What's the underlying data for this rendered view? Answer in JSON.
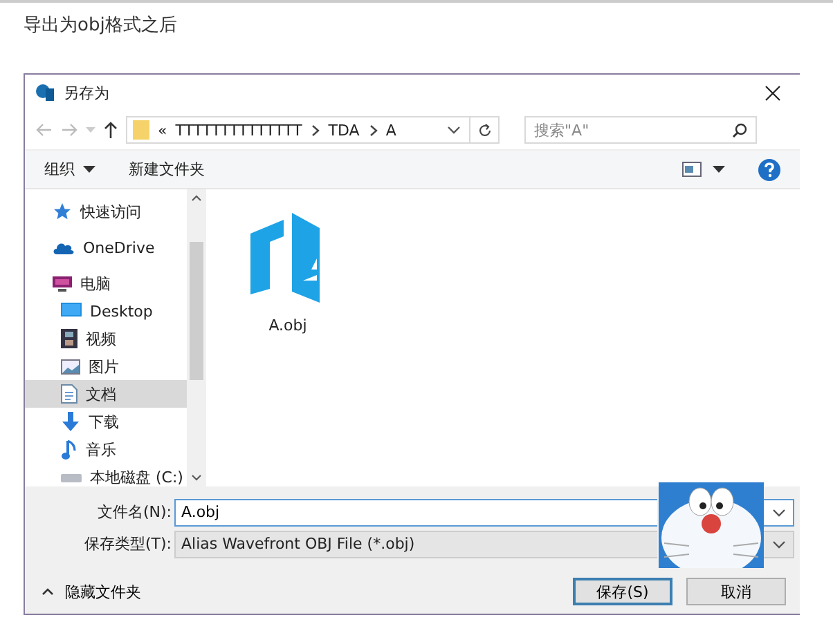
{
  "page_heading": "导出为obj格式之后",
  "dialog": {
    "title": "另存为",
    "path": {
      "overflow": "«",
      "segments": [
        "TTTTTTTTTTTTTT",
        "TDA",
        "A"
      ]
    },
    "search": {
      "placeholder": "搜索\"A\""
    },
    "toolbar": {
      "organize": "组织",
      "new_folder": "新建文件夹"
    },
    "sidebar": [
      {
        "label": "快速访问",
        "kind": "star",
        "selected": false
      },
      {
        "label": "OneDrive",
        "kind": "cloud",
        "selected": false
      },
      {
        "label": "电脑",
        "kind": "pc",
        "selected": false,
        "children": [
          {
            "label": "Desktop",
            "kind": "desktop",
            "selected": false
          },
          {
            "label": "视频",
            "kind": "video",
            "selected": false
          },
          {
            "label": "图片",
            "kind": "picture",
            "selected": false
          },
          {
            "label": "文档",
            "kind": "document",
            "selected": true
          },
          {
            "label": "下载",
            "kind": "download",
            "selected": false
          },
          {
            "label": "音乐",
            "kind": "music",
            "selected": false
          },
          {
            "label": "本地磁盘 (C:)",
            "kind": "drive",
            "selected": false
          }
        ]
      }
    ],
    "files": [
      {
        "name": "A.obj"
      }
    ],
    "file_name": {
      "label": "文件名(N):",
      "value": "A.obj"
    },
    "file_type": {
      "label": "保存类型(T):",
      "value": "Alias Wavefront OBJ File (*.obj)"
    },
    "hide_folders": "隐藏文件夹",
    "buttons": [
      {
        "label": "保存(S)",
        "default": true
      },
      {
        "label": "取消",
        "default": false
      }
    ]
  }
}
